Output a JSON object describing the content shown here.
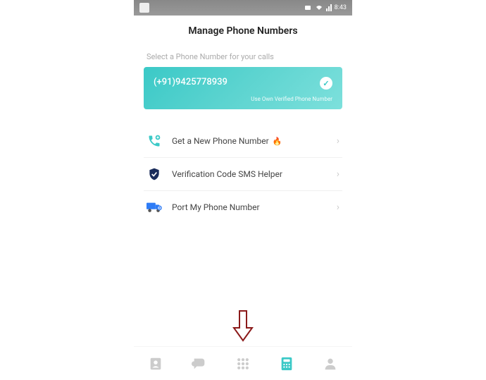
{
  "header": {
    "title": "Manage Phone Numbers"
  },
  "subtitle": "Select a Phone Number for your calls",
  "phone_card": {
    "number": "(+91)9425778939",
    "verified_text": "Use Own Verified Phone Number"
  },
  "options": [
    {
      "label": "Get a New Phone Number",
      "emoji": "🔥",
      "icon": "phone-add"
    },
    {
      "label": "Verification Code SMS Helper",
      "emoji": "",
      "icon": "shield"
    },
    {
      "label": "Port My Phone Number",
      "emoji": "",
      "icon": "truck"
    }
  ],
  "status_bar": {
    "time": "8:43"
  },
  "colors": {
    "primary": "#3bc9c7",
    "text_muted": "#aaa",
    "text_dark": "#444"
  }
}
